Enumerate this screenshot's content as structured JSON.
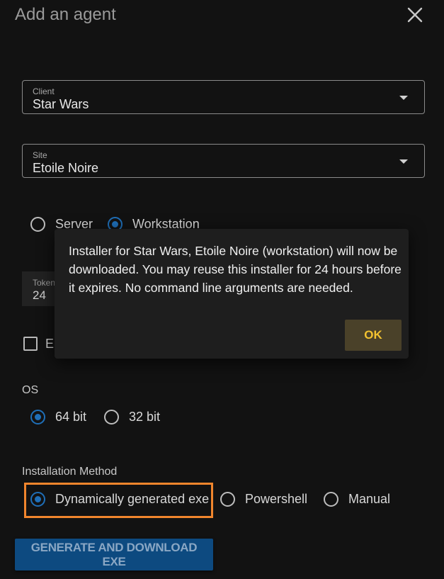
{
  "dialog_title": "Add an agent",
  "client": {
    "label": "Client",
    "value": "Star Wars"
  },
  "site": {
    "label": "Site",
    "value": "Etoile Noire"
  },
  "agent_type": {
    "server": "Server",
    "workstation": "Workstation",
    "selected": "workstation"
  },
  "token": {
    "label": "Token",
    "value": "24"
  },
  "checkbox_label_partial": "Er",
  "os": {
    "label": "OS",
    "bit64": "64 bit",
    "bit32": "32 bit",
    "selected": "64 bit"
  },
  "install_method": {
    "label": "Installation Method",
    "dynamic": "Dynamically generated exe",
    "powershell": "Powershell",
    "manual": "Manual",
    "selected": "Dynamically generated exe"
  },
  "generate_button": "GENERATE AND DOWNLOAD EXE",
  "popup": {
    "message": "Installer for Star Wars, Etoile Noire (workstation) will now be downloaded. You may reuse this installer for 24 hours before it expires. No command line arguments are needed.",
    "ok": "OK"
  },
  "colors": {
    "accent": "#1f6fb8",
    "highlight": "#f0852d",
    "ok_text": "#f2c230"
  }
}
